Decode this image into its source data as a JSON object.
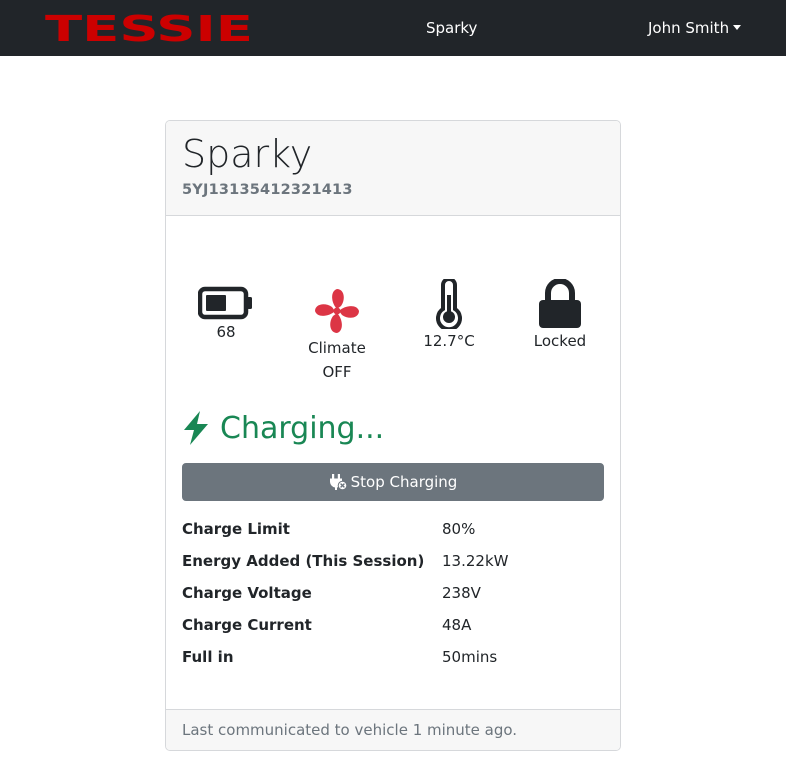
{
  "nav": {
    "brand": "TESSIE",
    "vehicle_link": "Sparky",
    "user": "John Smith"
  },
  "vehicle": {
    "name": "Sparky",
    "vin": "5YJ13135412321413"
  },
  "stats": {
    "battery": "68",
    "battery_icon": "battery-icon",
    "climate_line1": "Climate",
    "climate_line2": "OFF",
    "climate_icon": "fan-icon",
    "temperature": "12.7°C",
    "temperature_icon": "thermometer-icon",
    "lock": "Locked",
    "lock_icon": "lock-icon"
  },
  "charging": {
    "title": "Charging...",
    "icon": "lightning-bolt-icon",
    "stop_button": "Stop Charging"
  },
  "details": [
    {
      "label": "Charge Limit",
      "value": "80%"
    },
    {
      "label": "Energy Added (This Session)",
      "value": "13.22kW"
    },
    {
      "label": "Charge Voltage",
      "value": "238V"
    },
    {
      "label": "Charge Current",
      "value": "48A"
    },
    {
      "label": "Full in",
      "value": "50mins"
    }
  ],
  "footer": {
    "text": "Last communicated to vehicle 1 minute ago."
  },
  "colors": {
    "navbar": "#212529",
    "brand_red": "#cc0000",
    "success": "#198754",
    "secondary": "#6c757d",
    "fan_red": "#dc3545"
  }
}
